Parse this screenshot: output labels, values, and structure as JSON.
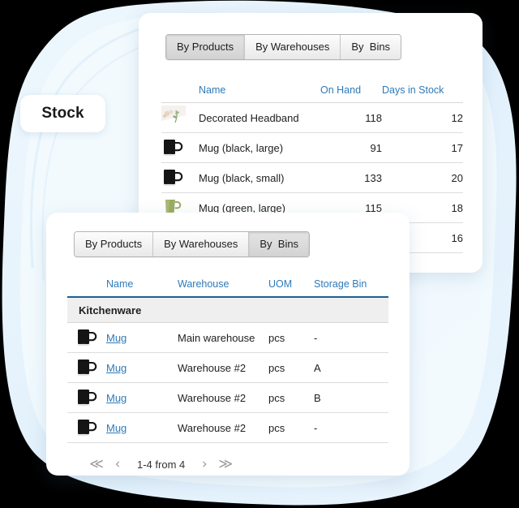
{
  "badge": {
    "label": "Stock"
  },
  "colors": {
    "backdrop": "#000000",
    "blob": "#e4f2fc",
    "blob_light": "#f2f9fe",
    "link": "#2f7ab8",
    "header_rule": "#1b5f96",
    "group_row": "#efefef",
    "card": "#ffffff"
  },
  "back_panel": {
    "tabs": [
      {
        "label": "By Products",
        "active": true
      },
      {
        "label": "By Warehouses",
        "active": false
      },
      {
        "label": "By  Bins",
        "active": false
      }
    ],
    "columns": [
      "",
      "Name",
      "On Hand",
      "Days in Stock"
    ],
    "rows": [
      {
        "icon": "headband-thumbnail",
        "name": "Decorated Headband",
        "on_hand": "118",
        "days_in_stock": "12"
      },
      {
        "icon": "black-mug-icon",
        "name": "Mug (black, large)",
        "on_hand": "91",
        "days_in_stock": "17"
      },
      {
        "icon": "black-mug-icon",
        "name": "Mug (black, small)",
        "on_hand": "133",
        "days_in_stock": "20"
      },
      {
        "icon": "green-mug-icon",
        "name": "Mug (green, large)",
        "on_hand": "115",
        "days_in_stock": "18"
      },
      {
        "icon": "",
        "name": "",
        "on_hand": "",
        "days_in_stock": "16"
      }
    ]
  },
  "front_panel": {
    "tabs": [
      {
        "label": "By Products",
        "active": false
      },
      {
        "label": "By Warehouses",
        "active": false
      },
      {
        "label": "By  Bins",
        "active": true
      }
    ],
    "columns": [
      "",
      "Name",
      "Warehouse",
      "UOM",
      "Storage Bin"
    ],
    "group_label": "Kitchenware",
    "rows": [
      {
        "icon": "black-mug-icon",
        "name": "Mug",
        "warehouse": "Main warehouse",
        "uom": "pcs",
        "storage_bin": "-"
      },
      {
        "icon": "black-mug-icon",
        "name": "Mug",
        "warehouse": "Warehouse #2",
        "uom": "pcs",
        "storage_bin": "A"
      },
      {
        "icon": "black-mug-icon",
        "name": "Mug",
        "warehouse": "Warehouse #2",
        "uom": "pcs",
        "storage_bin": "B"
      },
      {
        "icon": "black-mug-icon",
        "name": "Mug",
        "warehouse": "Warehouse #2",
        "uom": "pcs",
        "storage_bin": "-"
      }
    ],
    "pager": {
      "first": "≪",
      "prev": "‹",
      "label": "1-4 from 4",
      "next": "›",
      "last": "≫"
    }
  }
}
